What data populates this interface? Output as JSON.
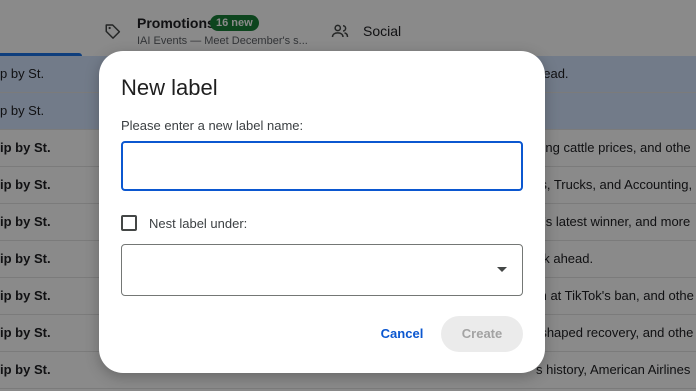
{
  "tabs": {
    "promotions": {
      "title": "Promotions",
      "badge": "16 new",
      "subtitle": "IAI Events — Meet December's s..."
    },
    "social": {
      "title": "Social"
    }
  },
  "rows": [
    {
      "sender": "p by St.",
      "snippet": "head.",
      "selected": true,
      "bold": false
    },
    {
      "sender": "p by St.",
      "snippet": "",
      "selected": true,
      "bold": false
    },
    {
      "sender": "ip by St.",
      "snippet": "sing cattle prices, and othe",
      "selected": false,
      "bold": true
    },
    {
      "sender": "ip by St.",
      "snippet": "rs, Trucks, and Accounting,",
      "selected": false,
      "bold": true
    },
    {
      "sender": "ip by St.",
      "snippet": "g's latest winner, and more",
      "selected": false,
      "bold": true
    },
    {
      "sender": "ip by St.",
      "snippet": "ek ahead.",
      "selected": false,
      "bold": true
    },
    {
      "sender": "ip by St.",
      "snippet": "m at TikTok's ban, and othe",
      "selected": false,
      "bold": true
    },
    {
      "sender": "ip by St.",
      "snippet": "-shaped recovery, and othe",
      "selected": false,
      "bold": true
    },
    {
      "sender": "ip by St.",
      "snippet": "s history, American Airlines",
      "selected": false,
      "bold": true
    }
  ],
  "dialog": {
    "title": "New label",
    "prompt": "Please enter a new label name:",
    "name_value": "",
    "nest_label": "Nest label under:",
    "nest_checked": false,
    "nest_selected": "",
    "cancel_label": "Cancel",
    "create_label": "Create"
  },
  "colors": {
    "accent": "#0b57d0",
    "badge": "#188038",
    "selected_row": "#d3e3fd"
  }
}
